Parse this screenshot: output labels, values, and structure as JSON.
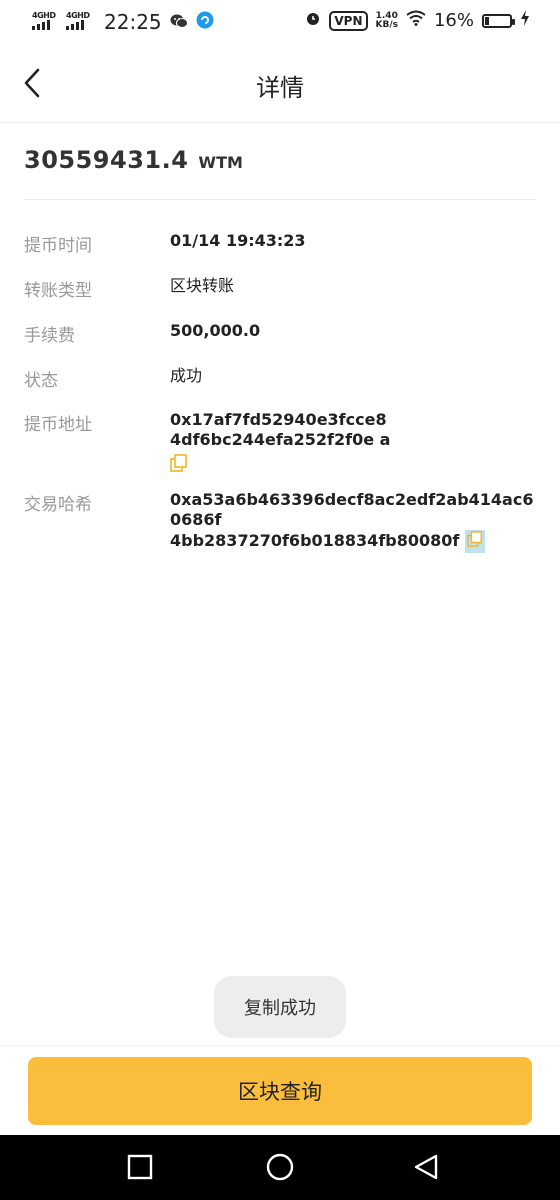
{
  "status_bar": {
    "signal_1": "4GHD",
    "signal_2": "4GHD",
    "time": "22:25",
    "vpn": "VPN",
    "speed_value": "1.40",
    "speed_unit": "KB/s",
    "battery_text": "16%",
    "battery_level": 0.16
  },
  "header": {
    "title": "详情"
  },
  "amount": {
    "value": "30559431.4",
    "unit": "WTM"
  },
  "details": {
    "time_label": "提币时间",
    "time_value": "01/14 19:43:23",
    "type_label": "转账类型",
    "type_value": "区块转账",
    "fee_label": "手续费",
    "fee_value": "500,000.0",
    "status_label": "状态",
    "status_value": "成功",
    "address_label": "提币地址",
    "address_line1": "0x17af7fd52940e3fcce8",
    "address_line2": "4df6bc244efa252f2f0e a",
    "hash_label": "交易哈希",
    "hash_line1": "0xa53a6b463396decf8ac2edf2ab414ac60686f",
    "hash_line2": "4bb2837270f6b018834fb80080f"
  },
  "toast": {
    "text": "复制成功"
  },
  "bottom": {
    "query_button": "区块查询"
  },
  "icons": {
    "accent": "#fbbd3c",
    "copy": "copy-icon"
  }
}
